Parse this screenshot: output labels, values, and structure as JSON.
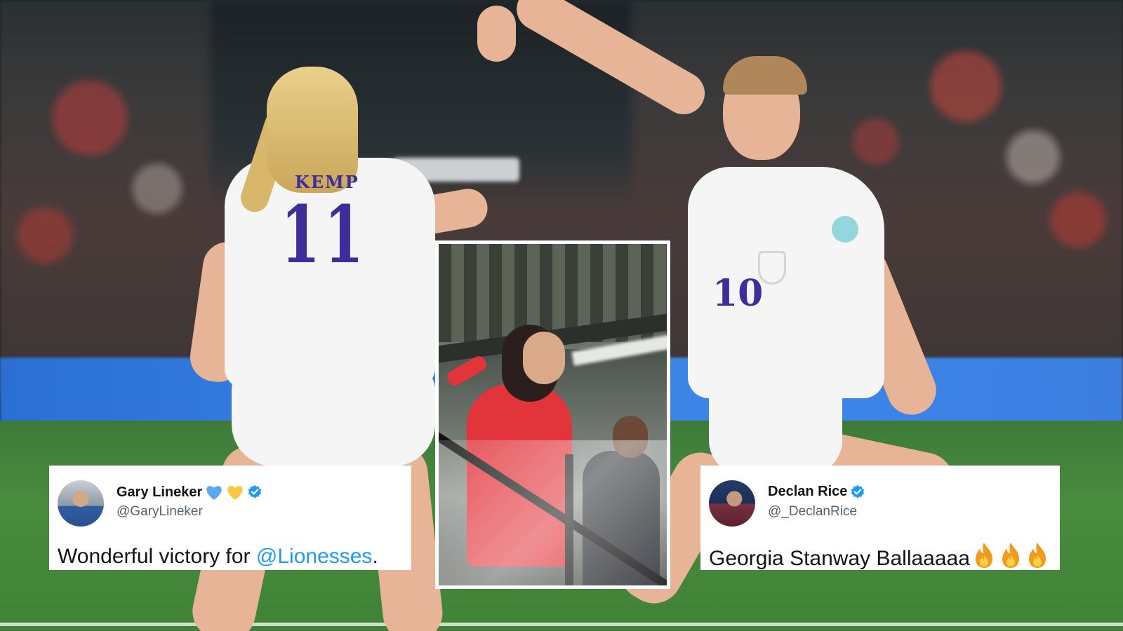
{
  "colors": {
    "verified_blue": "#1d9bf0",
    "mention_blue": "#1d9bf0",
    "heart_blue": "#5ea6f2",
    "heart_yellow": "#f7c843",
    "shirt_number_purple": "#3f2d9a",
    "inset_border": "#ffffff"
  },
  "scene": {
    "player_left": {
      "shirt_name": "KEMP",
      "shirt_number": "11"
    },
    "player_right": {
      "shirt_number": "10"
    }
  },
  "tweets": [
    {
      "display_name": "Gary Lineker",
      "emoji_icons": [
        "blue-heart-icon",
        "yellow-heart-icon"
      ],
      "verified_icon": "verified-badge-icon",
      "handle": "@GaryLineker",
      "text_before": "Wonderful victory for ",
      "mention": "@Lionesses",
      "text_after": "."
    },
    {
      "display_name": "Declan Rice",
      "verified_icon": "verified-badge-icon",
      "handle": "@_DeclanRice",
      "text": "Georgia Stanway Ballaaaaa",
      "emoji_icons": [
        "fire-icon",
        "fire-icon",
        "fire-icon"
      ]
    }
  ]
}
